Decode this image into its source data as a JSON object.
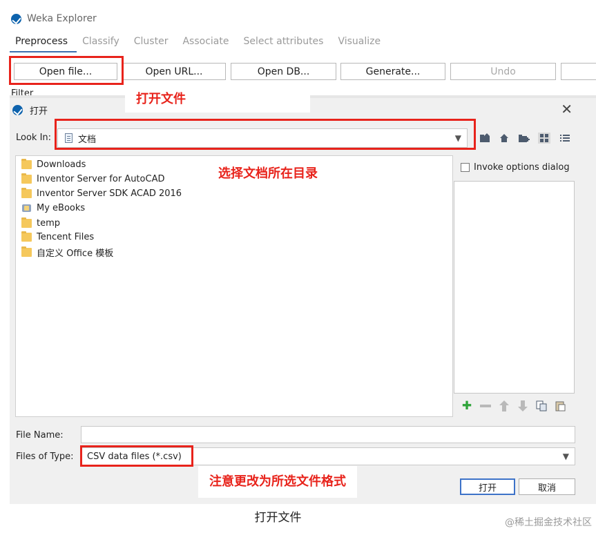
{
  "app": {
    "title": "Weka Explorer"
  },
  "tabs": [
    "Preprocess",
    "Classify",
    "Cluster",
    "Associate",
    "Select attributes",
    "Visualize"
  ],
  "toolbar": {
    "open_file": "Open file...",
    "open_url": "Open URL...",
    "open_db": "Open DB...",
    "generate": "Generate...",
    "undo": "Undo"
  },
  "filter_label": "Filter",
  "dialog": {
    "title": "打开",
    "look_in_label": "Look In:",
    "look_in_value": "文档",
    "files": [
      {
        "name": "Downloads",
        "icon": "folder-icon"
      },
      {
        "name": "Inventor Server for AutoCAD",
        "icon": "folder-icon"
      },
      {
        "name": "Inventor Server SDK ACAD 2016",
        "icon": "folder-icon"
      },
      {
        "name": "My eBooks",
        "icon": "library-icon"
      },
      {
        "name": "temp",
        "icon": "folder-icon"
      },
      {
        "name": "Tencent Files",
        "icon": "folder-icon"
      },
      {
        "name": "自定义 Office 模板",
        "icon": "folder-icon"
      }
    ],
    "invoke_options_label": "Invoke options dialog",
    "file_name_label": "File Name:",
    "file_name_value": "",
    "files_of_type_label": "Files of Type:",
    "files_of_type_value": "CSV data files (*.csv)",
    "open_button": "打开",
    "cancel_button": "取消"
  },
  "annotations": {
    "open_file": "打开文件",
    "choose_dir": "选择文档所在目录",
    "change_type": "注意更改为所选文件格式"
  },
  "caption": "打开文件",
  "watermark": "@稀土掘金技术社区",
  "colors": {
    "annotation": "#e8231b",
    "accent": "#3c72c8"
  }
}
